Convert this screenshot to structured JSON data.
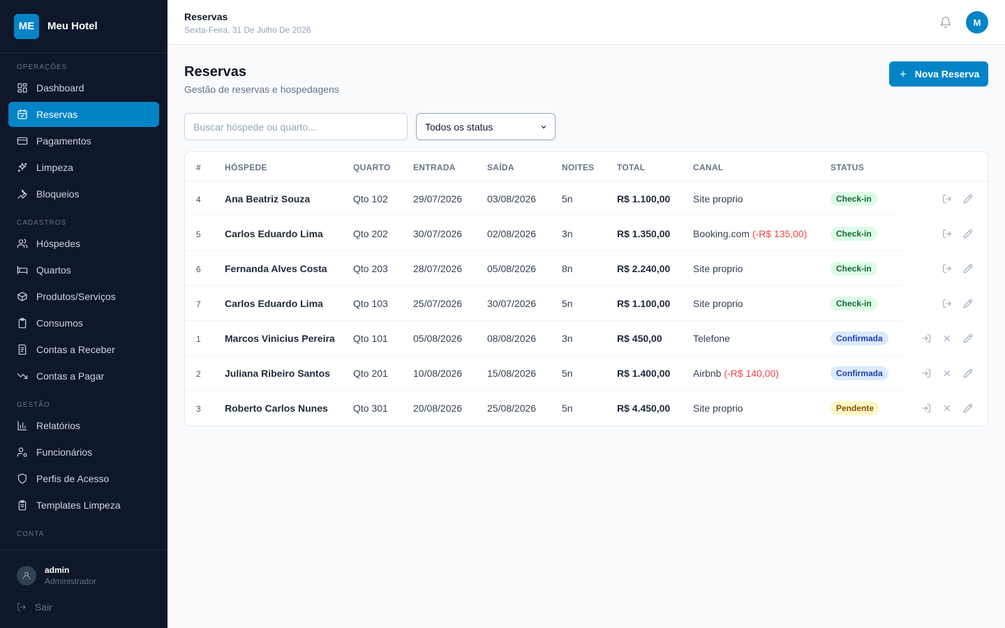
{
  "brand": {
    "initials": "ME",
    "name": "Meu Hotel"
  },
  "sidebar": {
    "sections": [
      {
        "label": "OPERAÇÕES"
      },
      {
        "label": "CADASTROS"
      },
      {
        "label": "GESTÃO"
      },
      {
        "label": "CONTA"
      }
    ],
    "items": [
      {
        "label": "Dashboard",
        "icon": "dashboard-icon"
      },
      {
        "label": "Reservas",
        "icon": "calendar-icon",
        "active": true
      },
      {
        "label": "Pagamentos",
        "icon": "credit-card-icon"
      },
      {
        "label": "Limpeza",
        "icon": "sparkles-icon"
      },
      {
        "label": "Bloqueios",
        "icon": "wrench-icon"
      },
      {
        "label": "Hóspedes",
        "icon": "users-icon"
      },
      {
        "label": "Quartos",
        "icon": "bed-icon"
      },
      {
        "label": "Produtos/Serviços",
        "icon": "package-icon"
      },
      {
        "label": "Consumos",
        "icon": "clipboard-icon"
      },
      {
        "label": "Contas a Receber",
        "icon": "receipt-icon"
      },
      {
        "label": "Contas a Pagar",
        "icon": "trending-down-icon"
      },
      {
        "label": "Relatórios",
        "icon": "bar-chart-icon"
      },
      {
        "label": "Funcionários",
        "icon": "user-cog-icon"
      },
      {
        "label": "Perfis de Acesso",
        "icon": "shield-icon"
      },
      {
        "label": "Templates Limpeza",
        "icon": "clipboard-list-icon"
      }
    ],
    "user": {
      "name": "admin",
      "role": "Administrador"
    },
    "logout_label": "Sair"
  },
  "header": {
    "title": "Reservas",
    "date": "Sexta-Feira, 31 De Julho De 2026",
    "avatar_initial": "M"
  },
  "main": {
    "title": "Reservas",
    "subtitle": "Gestão de reservas e hospedagens",
    "new_button_label": "Nova Reserva",
    "search_placeholder": "Buscar hóspede ou quarto...",
    "status_filter": "Todos os status"
  },
  "table": {
    "columns": [
      "#",
      "HÓSPEDE",
      "QUARTO",
      "ENTRADA",
      "SAÍDA",
      "NOITES",
      "TOTAL",
      "CANAL",
      "STATUS"
    ],
    "rows": [
      {
        "id": "4",
        "guest": "Ana Beatriz Souza",
        "room": "Qto 102",
        "checkin": "29/07/2026",
        "checkout": "03/08/2026",
        "nights": "5n",
        "total": "R$ 1.100,00",
        "channel": "Site proprio",
        "commission": "",
        "status": "Check-in",
        "status_type": "checkin"
      },
      {
        "id": "5",
        "guest": "Carlos Eduardo Lima",
        "room": "Qto 202",
        "checkin": "30/07/2026",
        "checkout": "02/08/2026",
        "nights": "3n",
        "total": "R$ 1.350,00",
        "channel": "Booking.com",
        "commission": "(-R$ 135,00)",
        "status": "Check-in",
        "status_type": "checkin"
      },
      {
        "id": "6",
        "guest": "Fernanda Alves Costa",
        "room": "Qto 203",
        "checkin": "28/07/2026",
        "checkout": "05/08/2026",
        "nights": "8n",
        "total": "R$ 2.240,00",
        "channel": "Site proprio",
        "commission": "",
        "status": "Check-in",
        "status_type": "checkin"
      },
      {
        "id": "7",
        "guest": "Carlos Eduardo Lima",
        "room": "Qto 103",
        "checkin": "25/07/2026",
        "checkout": "30/07/2026",
        "nights": "5n",
        "total": "R$ 1.100,00",
        "channel": "Site proprio",
        "commission": "",
        "status": "Check-in",
        "status_type": "checkin"
      },
      {
        "id": "1",
        "guest": "Marcos Vinicius Pereira",
        "room": "Qto 101",
        "checkin": "05/08/2026",
        "checkout": "08/08/2026",
        "nights": "3n",
        "total": "R$ 450,00",
        "channel": "Telefone",
        "commission": "",
        "status": "Confirmada",
        "status_type": "confirmed"
      },
      {
        "id": "2",
        "guest": "Juliana Ribeiro Santos",
        "room": "Qto 201",
        "checkin": "10/08/2026",
        "checkout": "15/08/2026",
        "nights": "5n",
        "total": "R$ 1.400,00",
        "channel": "Airbnb",
        "commission": "(-R$ 140,00)",
        "status": "Confirmada",
        "status_type": "confirmed"
      },
      {
        "id": "3",
        "guest": "Roberto Carlos Nunes",
        "room": "Qto 301",
        "checkin": "20/08/2026",
        "checkout": "25/08/2026",
        "nights": "5n",
        "total": "R$ 4.450,00",
        "channel": "Site proprio",
        "commission": "",
        "status": "Pendente",
        "status_type": "pending"
      }
    ]
  },
  "colors": {
    "sidebar_bg": "#0f172a",
    "accent": "#0284c7",
    "checkin": "#dcfce7",
    "confirmed": "#dbeafe",
    "pending": "#fef9c3",
    "commission": "#ef4444"
  }
}
